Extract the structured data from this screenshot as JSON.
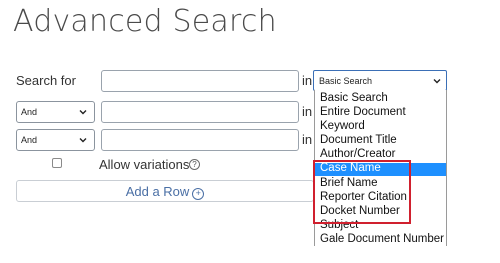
{
  "page": {
    "title": "Advanced Search"
  },
  "search_for": {
    "label": "Search for",
    "in_label": "in"
  },
  "rows": [
    {
      "operator": "And",
      "in_label": "in"
    },
    {
      "operator": "And",
      "in_label": "in"
    }
  ],
  "search_type": {
    "selected": "Basic Search",
    "options": [
      "Basic Search",
      "Entire Document",
      "Keyword",
      "Document Title",
      "Author/Creator",
      "Case Name",
      "Brief Name",
      "Reporter Citation",
      "Docket Number",
      "Subject",
      "Gale Document Number"
    ],
    "highlighted": "Case Name"
  },
  "allow_variations": {
    "label": "Allow variations",
    "help": "?"
  },
  "add_row": {
    "label": "Add a Row",
    "icon": "plus-circle-icon"
  },
  "colors": {
    "highlight_blue": "#1e90ff",
    "annotation_red": "#d0202e",
    "link_blue": "#4a6fa5"
  }
}
